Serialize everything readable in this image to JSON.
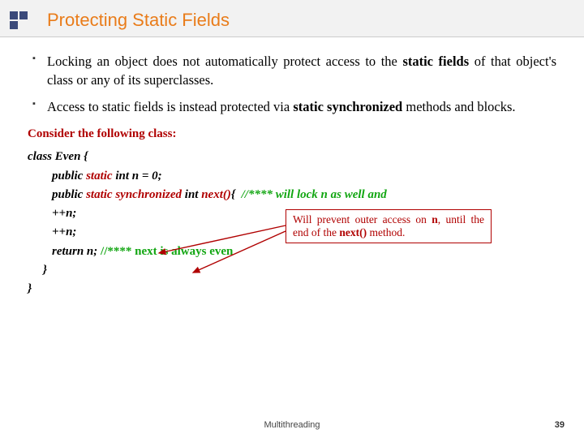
{
  "title": "Protecting Static Fields",
  "bullets": [
    {
      "pre": "Locking an object does not automatically protect access to the ",
      "b": "static fields",
      "post": " of that object's class or any of its superclasses."
    },
    {
      "pre": "Access to static fields is instead protected via ",
      "b": "static synchronized",
      "post": " methods and blocks."
    }
  ],
  "subhead": "Consider the following class:",
  "code": {
    "l1a": "class Even {",
    "l2a": "        public ",
    "l2b": "static",
    "l2c": " int n = 0;",
    "l3a": "        public ",
    "l3b": "static synchronized",
    "l3c": " int ",
    "l3d": "next()",
    "l3e": "{  ",
    "l3f": "//**** will lock n as well and",
    "l4": "        ++n;",
    "l5": "        ++n;",
    "l6a": "        return n; ",
    "l6b": "//**** next is always even",
    "l7": "     }",
    "l8": "}"
  },
  "callout": {
    "pre": "Will prevent outer access on ",
    "b1": "n",
    "mid": ", until the end of the ",
    "b2": "next()",
    "post": " method."
  },
  "footer": "Multithreading",
  "page": "39"
}
